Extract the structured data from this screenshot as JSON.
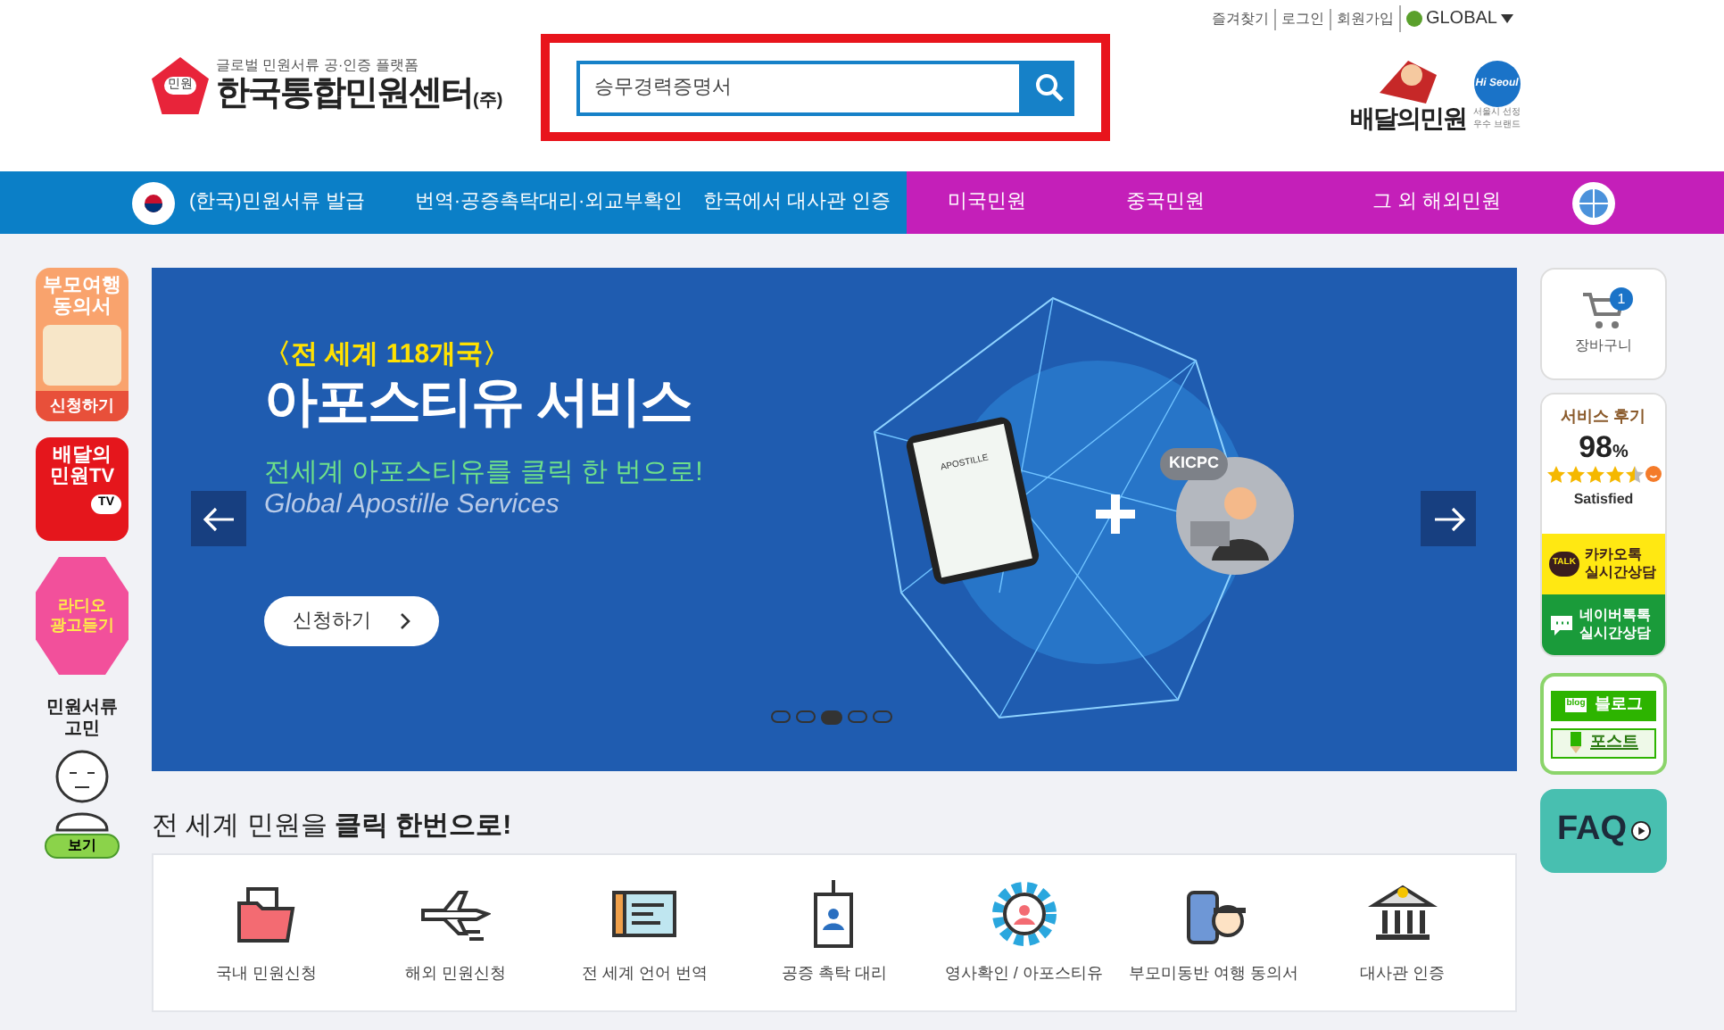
{
  "top_links": [
    {
      "label": "즐겨찾기"
    },
    {
      "label": "로그인"
    },
    {
      "label": "회원가입"
    },
    {
      "label": "GLOBAL",
      "kind": "global"
    }
  ],
  "brand": {
    "tagline": "글로벌 민원서류 공·인증 플랫폼",
    "name": "한국통합민원센터",
    "suffix": "(주)",
    "emblem": "민원"
  },
  "search": {
    "value": "승무경력증명서"
  },
  "partner": {
    "name": "배달의민원",
    "badge": "Hi Seoul",
    "note": [
      "서울시 선정",
      "우수 브랜드"
    ]
  },
  "nav": [
    {
      "label": "(한국)민원서류 발급",
      "color": "#0b7fc7"
    },
    {
      "label": "번역·공증촉탁대리·외교부확인",
      "color": "#0b7fc7"
    },
    {
      "label": "한국에서 대사관 인증",
      "color": "#0b7fc7"
    },
    {
      "label": "미국민원",
      "color": "#c41fb9"
    },
    {
      "label": "중국민원",
      "color": "#c41fb9"
    },
    {
      "label": "그 외 해외민원",
      "color": "#c41fb9"
    }
  ],
  "side_banners": [
    {
      "kind": "travel",
      "lines": [
        "부모여행",
        "동의서"
      ],
      "action": "신청하기"
    },
    {
      "kind": "tv",
      "lines": [
        "배달의",
        "민원TV"
      ],
      "badge": "TV"
    },
    {
      "kind": "radio",
      "lines": [
        "라디오",
        "광고듣기"
      ]
    },
    {
      "kind": "gomin",
      "lines": [
        "민원서류",
        "고민"
      ],
      "action": "보기"
    }
  ],
  "hero": {
    "kicker": "〈전 세계 118개국〉",
    "title": "아포스티유 서비스",
    "subtitle": "전세계 아포스티유를 클릭 한 번으로!",
    "subtitle_en": "Global Apostille Services",
    "button": "신청하기",
    "badge": "KICPC",
    "document": "APOSTILLE",
    "dots": [
      {
        "selected": false
      },
      {
        "selected": false
      },
      {
        "selected": true
      },
      {
        "selected": false
      },
      {
        "selected": false
      }
    ]
  },
  "cart": {
    "label": "장바구니",
    "count": "1"
  },
  "review": {
    "title": "서비스 후기",
    "percent": "98",
    "unit": "%",
    "stars": 4.5,
    "label": "Satisfied"
  },
  "chat": [
    {
      "kind": "kakao",
      "lines": [
        "카카오톡",
        "실시간상담"
      ],
      "icon": "TALK"
    },
    {
      "kind": "naver",
      "lines": [
        "네이버톡톡",
        "실시간상담"
      ]
    }
  ],
  "sns": [
    {
      "kind": "blog",
      "label": "블로그",
      "icon": "blog"
    },
    {
      "kind": "post",
      "label": "포스트"
    }
  ],
  "faq": "FAQ",
  "section_title": "전 세계 민원을 **클릭 한번으로!**",
  "services": [
    {
      "kind": "folder",
      "label": "국내 민원신청"
    },
    {
      "kind": "plane",
      "label": "해외 민원신청"
    },
    {
      "kind": "ticket",
      "label": "전 세계 언어 번역"
    },
    {
      "kind": "badge",
      "label": "공증 촉탁 대리"
    },
    {
      "kind": "gear",
      "label": "영사확인 / 아포스티유"
    },
    {
      "kind": "luggage",
      "label": "부모미동반 여행 동의서"
    },
    {
      "kind": "bank",
      "label": "대사관 인증"
    }
  ]
}
